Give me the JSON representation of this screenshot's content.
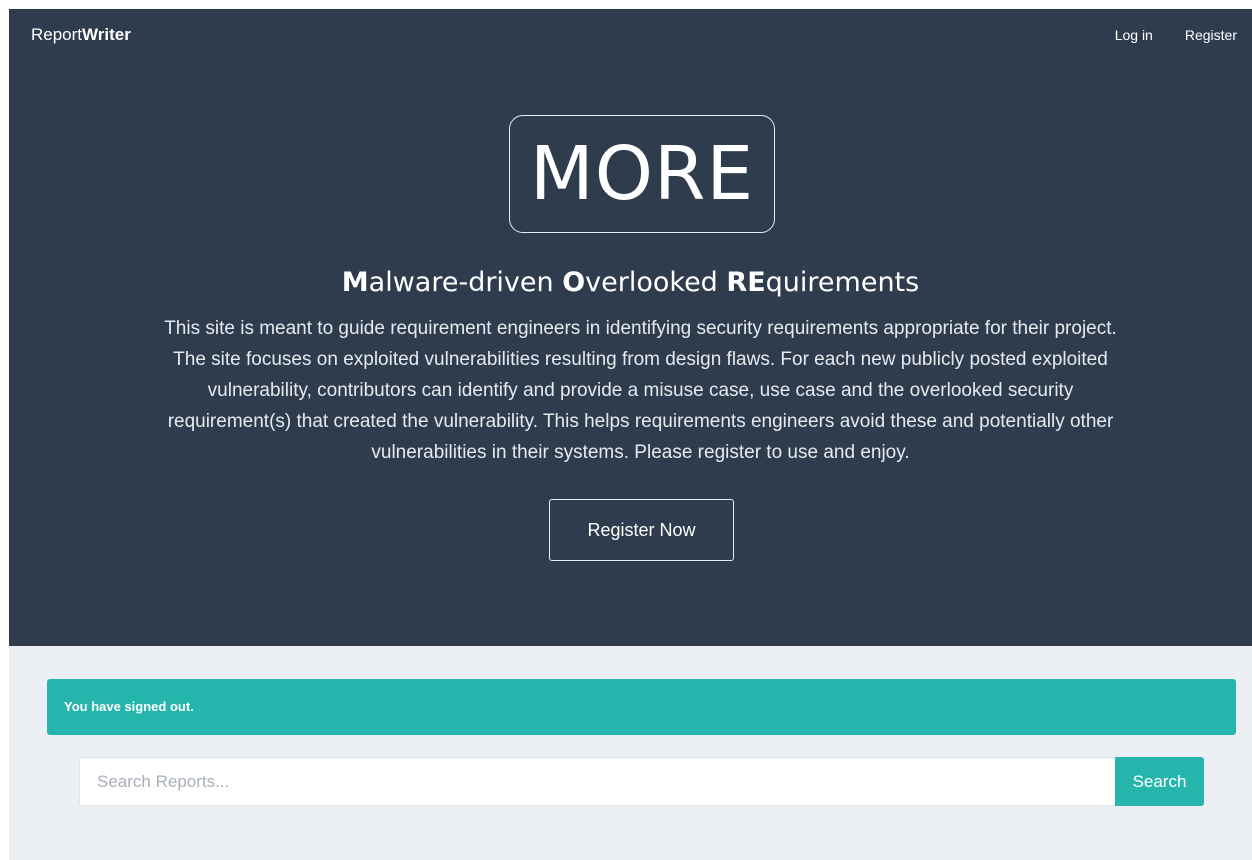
{
  "navbar": {
    "brand_regular": "Report",
    "brand_bold": "Writer",
    "login_label": "Log in",
    "register_label": "Register"
  },
  "hero": {
    "logo_text": "MORE",
    "title_parts": [
      {
        "bold": "M",
        "rest": "alware-driven "
      },
      {
        "bold": "O",
        "rest": "verlooked "
      },
      {
        "bold": "RE",
        "rest": "quirements"
      }
    ],
    "description": "This site is meant to guide requirement engineers in identifying security requirements appropriate for their project. The site focuses on exploited vulnerabilities resulting from design flaws. For each new publicly posted exploited vulnerability, contributors can identify and provide a misuse case, use case and the overlooked security requirement(s) that created the vulnerability. This helps requirements engineers avoid these and potentially other vulnerabilities in their systems. Please register to use and enjoy.",
    "register_now_label": "Register Now"
  },
  "alert": {
    "message": "You have signed out."
  },
  "search": {
    "placeholder": "Search Reports...",
    "value": "",
    "button_label": "Search"
  },
  "colors": {
    "hero_background": "#2e3c4d",
    "page_background": "#eceff4",
    "accent_teal": "#26b5ad"
  }
}
